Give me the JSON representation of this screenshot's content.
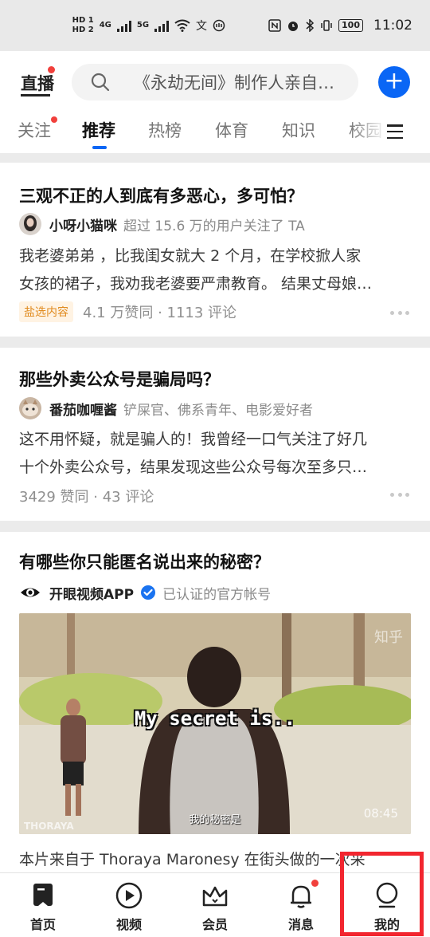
{
  "status_bar": {
    "hd1": "HD 1",
    "hd2": "HD 2",
    "net1": "4G",
    "net2": "5G",
    "battery": "100",
    "time": "11:02"
  },
  "header": {
    "live_label": "直播",
    "search_placeholder": "《永劫无间》制作人亲自下场…",
    "add_button": "+"
  },
  "tabs": [
    {
      "label": "关注"
    },
    {
      "label": "推荐"
    },
    {
      "label": "热榜"
    },
    {
      "label": "体育"
    },
    {
      "label": "知识"
    },
    {
      "label": "校园"
    }
  ],
  "feed": [
    {
      "title": "三观不正的人到底有多恶心，多可怕？",
      "author": "小呀小猫咪",
      "author_desc": "超过 15.6 万的用户关注了 TA",
      "excerpt_lines": [
        "我老婆弟弟 ，比我闺女就大 2 个月，在学校掀人家",
        "女孩的裙子，我劝我老婆要严肃教育。 结果丈母娘…"
      ],
      "tag": "盐选内容",
      "stats": "4.1 万赞同 · 1113 评论"
    },
    {
      "title": "那些外卖公众号是骗局吗？",
      "author": "番茄咖喱酱",
      "author_desc": "铲屎官、佛系青年、电影爱好者",
      "excerpt_lines": [
        "这不用怀疑，就是骗人的！我曾经一口气关注了好几",
        "十个外卖公众号，结果发现这些公众号每次至多只…"
      ],
      "stats": "3429 赞同 · 43 评论"
    },
    {
      "title": "有哪些你只能匿名说出来的秘密？",
      "author": "开眼视频APP",
      "author_desc": "已认证的官方帐号",
      "video": {
        "caption": "My secret is..",
        "subtitle": "我的秘密是",
        "duration": "08:45",
        "watermark_left": "THORAYA",
        "watermark_right": "知乎"
      },
      "description": "本片来自于 Thoraya Maronesy 在街头做的一次采"
    }
  ],
  "bottom_nav": [
    {
      "label": "首页"
    },
    {
      "label": "视频"
    },
    {
      "label": "会员"
    },
    {
      "label": "消息"
    },
    {
      "label": "我的"
    }
  ],
  "colors": {
    "accent": "#0a66f5",
    "badge": "#f1403c",
    "tag_bg": "#fff3e3",
    "tag_fg": "#e08a1e",
    "highlight": "#f2262f"
  }
}
